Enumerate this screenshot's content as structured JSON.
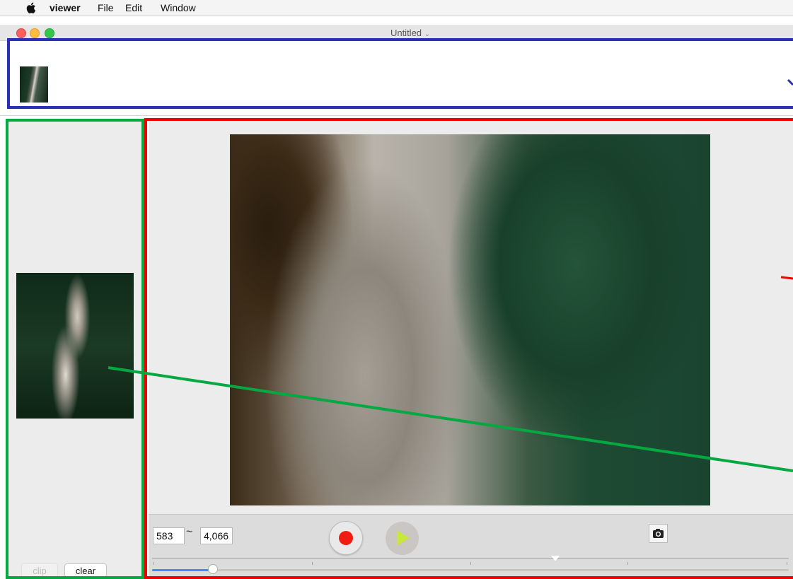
{
  "menubar": {
    "app_name": "viewer",
    "items": [
      "File",
      "Edit",
      "Window"
    ]
  },
  "window": {
    "title": "Untitled"
  },
  "left_panel": {
    "clip_label": "clip",
    "clear_label": "clear"
  },
  "controls": {
    "start_frame": "583",
    "range_separator": "~",
    "end_frame": "4,066",
    "playhead_fraction": 0.09
  },
  "colors": {
    "thumbnail_strip_annotation": "#2b2fb8",
    "clip_panel_annotation": "#06a841",
    "viewer_annotation": "#f00000",
    "record": "#f21d12",
    "play": "#c9e63a",
    "slider_accent": "#3a8ef5"
  },
  "icons": [
    "apple-icon",
    "record-icon",
    "play-icon",
    "camera-icon"
  ]
}
